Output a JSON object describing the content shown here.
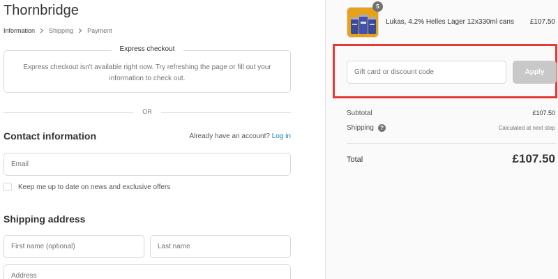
{
  "store": {
    "name": "Thornbridge"
  },
  "breadcrumb": {
    "items": [
      {
        "label": "Information"
      },
      {
        "label": "Shipping"
      },
      {
        "label": "Payment"
      }
    ]
  },
  "express": {
    "title": "Express checkout",
    "message": "Express checkout isn't available right now. Try refreshing the page or fill out your information to check out."
  },
  "divider": {
    "or": "OR"
  },
  "contact": {
    "title": "Contact information",
    "login_prompt": "Already have an account?",
    "login_link": "Log in",
    "email_placeholder": "Email",
    "newsletter_label": "Keep me up to date on news and exclusive offers"
  },
  "shipping": {
    "title": "Shipping address",
    "first_name_placeholder": "First name (optional)",
    "last_name_placeholder": "Last name",
    "address_placeholder": "Address"
  },
  "order": {
    "product": {
      "name": "Lukas, 4.2% Helles Lager 12x330ml cans",
      "price": "£107.50",
      "quantity": "5",
      "icon": "beer-cans-thumbnail"
    },
    "discount": {
      "placeholder": "Gift card or discount code",
      "apply_label": "Apply"
    },
    "subtotal": {
      "label": "Subtotal",
      "value": "£107.50"
    },
    "shipping": {
      "label": "Shipping",
      "value": "Calculated at next step",
      "help": "?"
    },
    "total": {
      "label": "Total",
      "value": "£107.50"
    }
  },
  "colors": {
    "link": "#197bbd",
    "highlight": "#e53935",
    "apply_disabled": "#c8c8c8",
    "thumbnail_bg": "#e8a21a"
  }
}
